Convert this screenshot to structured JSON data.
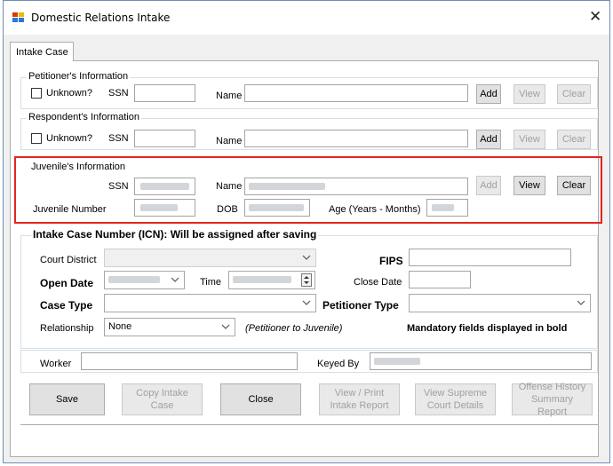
{
  "window": {
    "title": "Domestic Relations Intake"
  },
  "tabs": [
    {
      "label": "Intake Case"
    }
  ],
  "petitioner": {
    "legend": "Petitioner's Information",
    "unknown_label": "Unknown?",
    "ssn_label": "SSN",
    "name_label": "Name",
    "add": "Add",
    "view": "View",
    "clear": "Clear"
  },
  "respondent": {
    "legend": "Respondent's Information",
    "unknown_label": "Unknown?",
    "ssn_label": "SSN",
    "name_label": "Name",
    "add": "Add",
    "view": "View",
    "clear": "Clear"
  },
  "juvenile": {
    "legend": "Juvenile's Information",
    "ssn_label": "SSN",
    "name_label": "Name",
    "number_label": "Juvenile Number",
    "dob_label": "DOB",
    "age_label": "Age (Years - Months)",
    "add": "Add",
    "view": "View",
    "clear": "Clear"
  },
  "intake": {
    "legend": "Intake Case Number (ICN): Will be assigned after saving",
    "court_district_label": "Court District",
    "fips_label": "FIPS",
    "open_date_label": "Open Date",
    "time_label": "Time",
    "close_date_label": "Close Date",
    "case_type_label": "Case Type",
    "petitioner_type_label": "Petitioner Type",
    "relationship_label": "Relationship",
    "relationship_value": "None",
    "relationship_note": "(Petitioner to Juvenile)",
    "mandatory_note": "Mandatory fields displayed in bold"
  },
  "worker": {
    "worker_label": "Worker",
    "keyed_by_label": "Keyed By"
  },
  "buttons": {
    "save": "Save",
    "copy": "Copy Intake Case",
    "close": "Close",
    "view_print": "View / Print Intake Report",
    "view_supreme": "View Supreme Court Details",
    "offense_history": "Offense History Summary Report"
  },
  "colors": {
    "highlight": "#e0261f",
    "accent_border": "#6b8fb5"
  }
}
